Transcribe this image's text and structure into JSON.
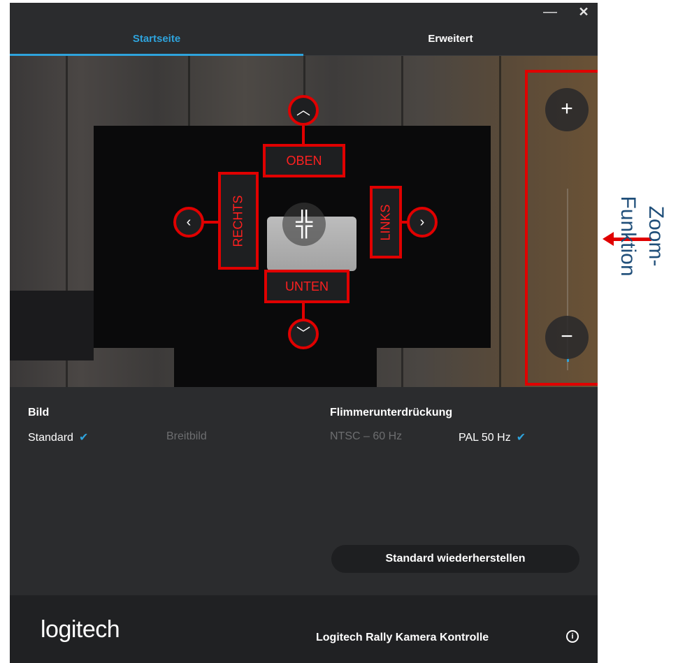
{
  "window": {
    "minimize_glyph": "—",
    "close_glyph": "✕"
  },
  "tabs": [
    {
      "label": "Startseite",
      "active": true
    },
    {
      "label": "Erweitert",
      "active": false
    }
  ],
  "preview": {
    "controls": {
      "up_label": "OBEN",
      "down_label": "UNTEN",
      "left_label": "RECHTS",
      "right_label": "LINKS",
      "up_glyph": "︿",
      "down_glyph": "﹀",
      "left_glyph": "‹",
      "right_glyph": "›",
      "center_glyph": "╬"
    },
    "zoom": {
      "plus_glyph": "+",
      "minus_glyph": "−",
      "level": 0.05
    }
  },
  "settings": {
    "bild": {
      "title": "Bild",
      "options": [
        {
          "label": "Standard",
          "selected": true
        },
        {
          "label": "Breitbild",
          "selected": false
        }
      ]
    },
    "flicker": {
      "title": "Flimmerunterdrückung",
      "options": [
        {
          "label": "NTSC – 60 Hz",
          "selected": false
        },
        {
          "label": "PAL 50 Hz",
          "selected": true
        }
      ]
    },
    "checkmark": "✔",
    "reset_label": "Standard wiederherstellen"
  },
  "footer": {
    "logo": "logitech",
    "title": "Logitech Rally Kamera Kontrolle",
    "info_glyph": "i"
  },
  "annotation": {
    "side_label": "Zoom-Funktion"
  },
  "colors": {
    "accent": "#2ea3dc",
    "highlight": "#e00000",
    "side_label": "#1f4e79"
  }
}
